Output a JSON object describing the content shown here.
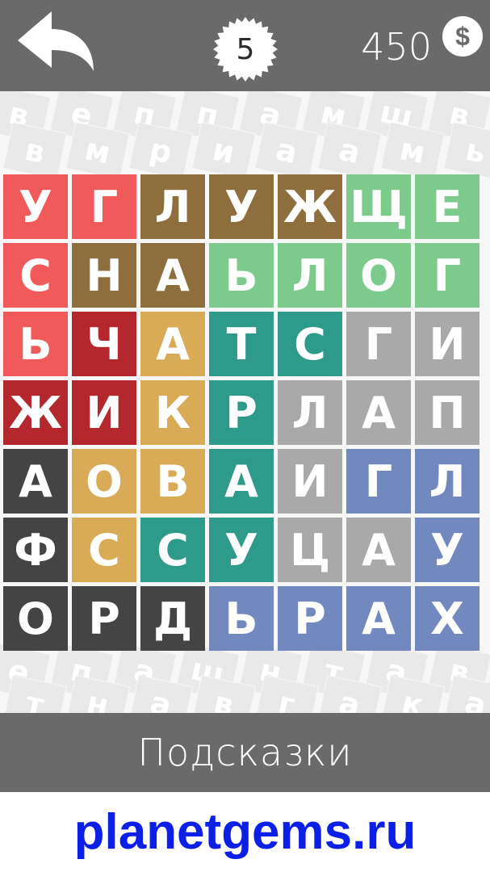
{
  "header": {
    "back_icon": "back-arrow-icon",
    "level": "5",
    "coins": "450",
    "coin_icon": "dollar-coin-icon",
    "coin_symbol": "$"
  },
  "grid": {
    "rows": [
      [
        "У",
        "Г",
        "Л",
        "У",
        "Ж",
        "Щ",
        "Е"
      ],
      [
        "С",
        "Н",
        "А",
        "Ь",
        "Л",
        "О",
        "Г"
      ],
      [
        "Ь",
        "Ч",
        "А",
        "Т",
        "С",
        "Г",
        "И"
      ],
      [
        "Ж",
        "И",
        "К",
        "Р",
        "Л",
        "А",
        "П"
      ],
      [
        "А",
        "О",
        "В",
        "А",
        "И",
        "Г",
        "Л"
      ],
      [
        "Ф",
        "С",
        "С",
        "У",
        "Ц",
        "А",
        "У"
      ],
      [
        "О",
        "Р",
        "Д",
        "Ь",
        "Р",
        "А",
        "Х"
      ]
    ],
    "colors": [
      [
        "#f15a5a",
        "#f15a5a",
        "#8f6e3e",
        "#8f6e3e",
        "#8f6e3e",
        "#7dcb8c",
        "#7dcb8c"
      ],
      [
        "#f15a5a",
        "#8f6e3e",
        "#8f6e3e",
        "#7dcb8c",
        "#7dcb8c",
        "#7dcb8c",
        "#7dcb8c"
      ],
      [
        "#f15a5a",
        "#b3272d",
        "#d9ab56",
        "#2e9a8a",
        "#2e9a8a",
        "#a9a9a9",
        "#a9a9a9"
      ],
      [
        "#b3272d",
        "#b3272d",
        "#d9ab56",
        "#2e9a8a",
        "#a9a9a9",
        "#a9a9a9",
        "#a9a9a9"
      ],
      [
        "#444444",
        "#d9ab56",
        "#d9ab56",
        "#2e9a8a",
        "#a9a9a9",
        "#7289bf",
        "#7289bf"
      ],
      [
        "#444444",
        "#d9ab56",
        "#2e9a8a",
        "#2e9a8a",
        "#a9a9a9",
        "#a9a9a9",
        "#7289bf"
      ],
      [
        "#444444",
        "#444444",
        "#444444",
        "#7289bf",
        "#7289bf",
        "#7289bf",
        "#7289bf"
      ]
    ]
  },
  "background_letters": {
    "row1": [
      "в",
      "е",
      "п",
      "п",
      "а",
      "м",
      "ш",
      "в"
    ],
    "row2": [
      "в",
      "м",
      "р",
      "и",
      "а",
      "а",
      "м",
      "ь"
    ],
    "row3": [
      "е",
      "п",
      "а",
      "ш",
      "н",
      "т",
      "а",
      "в"
    ],
    "row4": [
      "т",
      "н",
      "а",
      "в",
      "г",
      "а",
      "к",
      "а"
    ]
  },
  "footer": {
    "hints_label": "Подсказки"
  },
  "watermark": {
    "text": "planetgems.ru"
  }
}
